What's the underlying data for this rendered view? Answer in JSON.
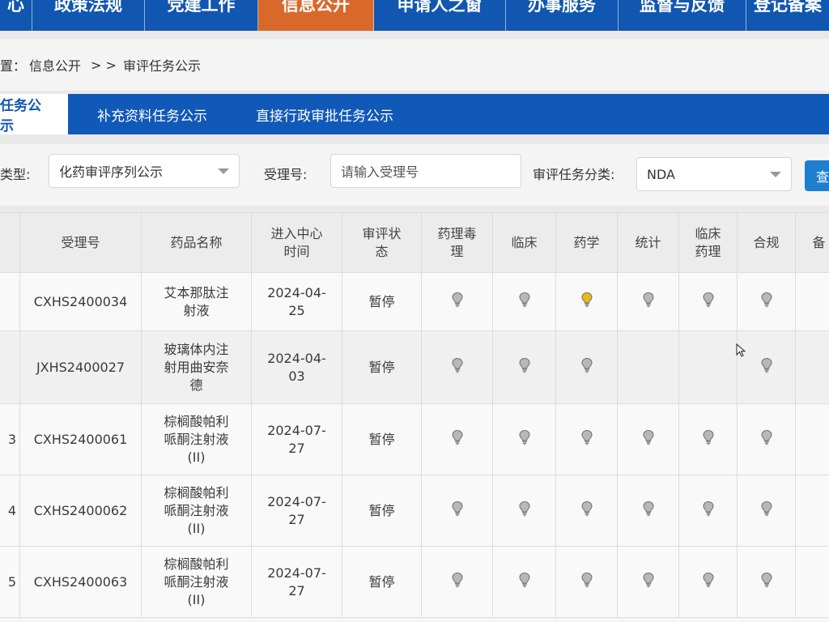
{
  "nav": {
    "items": [
      {
        "label": "心"
      },
      {
        "label": "政策法规"
      },
      {
        "label": "党建工作"
      },
      {
        "label": "信息公开"
      },
      {
        "label": "申请人之窗"
      },
      {
        "label": "办事服务"
      },
      {
        "label": "监督与反馈"
      },
      {
        "label": "登记备案"
      }
    ],
    "active": "信息公开"
  },
  "breadcrumb": {
    "prefix": "置：",
    "section": "信息公开",
    "separator": "> >",
    "current": "审评任务公示"
  },
  "tabs": [
    {
      "label": "任务公示",
      "active": true
    },
    {
      "label": "补充资料任务公示",
      "active": false
    },
    {
      "label": "直接行政审批任务公示",
      "active": false
    }
  ],
  "filters": {
    "type_label": "类型:",
    "type_value": "化药审评序列公示",
    "accept_label": "受理号:",
    "accept_placeholder": "请输入受理号",
    "category_label": "审评任务分类:",
    "category_value": "NDA",
    "query_button": "查"
  },
  "table": {
    "headers": [
      "",
      "受理号",
      "药品名称",
      "进入中心时间",
      "审评状态",
      "药理毒理",
      "临床",
      "药学",
      "统计",
      "临床药理",
      "合规",
      "备"
    ],
    "rows": [
      {
        "idx": "",
        "accept_no": "CXHS2400034",
        "name": "艾本那肽注射液",
        "date": "2024-04-25",
        "status": "暂停",
        "bulbs": [
          "grey",
          "grey",
          "yellow",
          "grey",
          "grey",
          "grey"
        ]
      },
      {
        "idx": "",
        "accept_no": "JXHS2400027",
        "name": "玻璃体内注射用曲安奈德",
        "date": "2024-04-03",
        "status": "暂停",
        "bulbs": [
          "grey",
          "grey",
          "grey",
          "",
          "",
          "grey"
        ]
      },
      {
        "idx": "3",
        "accept_no": "CXHS2400061",
        "name": "棕榈酸帕利哌酮注射液(II)",
        "date": "2024-07-27",
        "status": "暂停",
        "bulbs": [
          "grey",
          "grey",
          "grey",
          "grey",
          "grey",
          "grey"
        ]
      },
      {
        "idx": "4",
        "accept_no": "CXHS2400062",
        "name": "棕榈酸帕利哌酮注射液(II)",
        "date": "2024-07-27",
        "status": "暂停",
        "bulbs": [
          "grey",
          "grey",
          "grey",
          "grey",
          "grey",
          "grey"
        ]
      },
      {
        "idx": "5",
        "accept_no": "CXHS2400063",
        "name": "棕榈酸帕利哌酮注射液(II)",
        "date": "2024-07-27",
        "status": "暂停",
        "bulbs": [
          "grey",
          "grey",
          "grey",
          "grey",
          "grey",
          "grey"
        ]
      }
    ]
  },
  "colors": {
    "nav_bg": "#1156b0",
    "nav_active": "#d8692b",
    "bulb_grey": "#b8b8b8",
    "bulb_yellow": "#e6b81c"
  }
}
